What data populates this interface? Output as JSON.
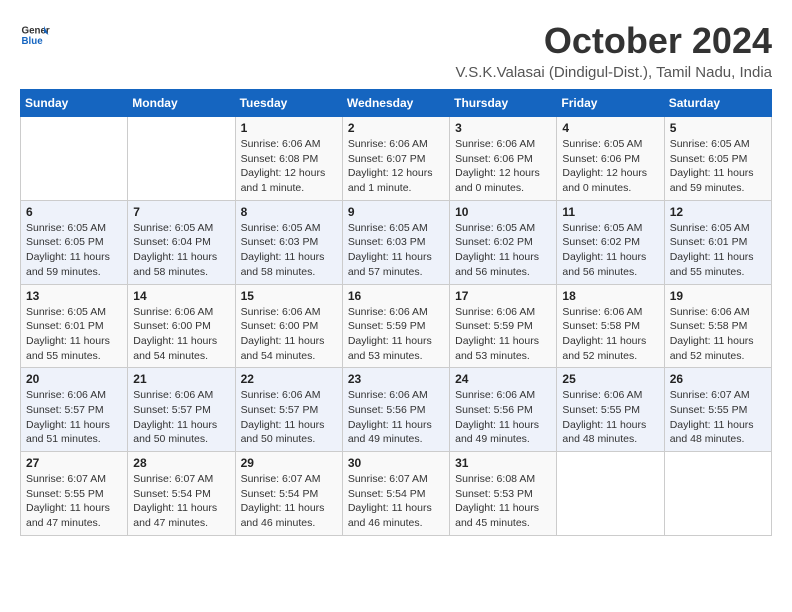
{
  "header": {
    "logo_general": "General",
    "logo_blue": "Blue",
    "title": "October 2024",
    "location": "V.S.K.Valasai (Dindigul-Dist.), Tamil Nadu, India"
  },
  "columns": [
    "Sunday",
    "Monday",
    "Tuesday",
    "Wednesday",
    "Thursday",
    "Friday",
    "Saturday"
  ],
  "weeks": [
    [
      {
        "day": "",
        "detail": ""
      },
      {
        "day": "",
        "detail": ""
      },
      {
        "day": "1",
        "detail": "Sunrise: 6:06 AM\nSunset: 6:08 PM\nDaylight: 12 hours\nand 1 minute."
      },
      {
        "day": "2",
        "detail": "Sunrise: 6:06 AM\nSunset: 6:07 PM\nDaylight: 12 hours\nand 1 minute."
      },
      {
        "day": "3",
        "detail": "Sunrise: 6:06 AM\nSunset: 6:06 PM\nDaylight: 12 hours\nand 0 minutes."
      },
      {
        "day": "4",
        "detail": "Sunrise: 6:05 AM\nSunset: 6:06 PM\nDaylight: 12 hours\nand 0 minutes."
      },
      {
        "day": "5",
        "detail": "Sunrise: 6:05 AM\nSunset: 6:05 PM\nDaylight: 11 hours\nand 59 minutes."
      }
    ],
    [
      {
        "day": "6",
        "detail": "Sunrise: 6:05 AM\nSunset: 6:05 PM\nDaylight: 11 hours\nand 59 minutes."
      },
      {
        "day": "7",
        "detail": "Sunrise: 6:05 AM\nSunset: 6:04 PM\nDaylight: 11 hours\nand 58 minutes."
      },
      {
        "day": "8",
        "detail": "Sunrise: 6:05 AM\nSunset: 6:03 PM\nDaylight: 11 hours\nand 58 minutes."
      },
      {
        "day": "9",
        "detail": "Sunrise: 6:05 AM\nSunset: 6:03 PM\nDaylight: 11 hours\nand 57 minutes."
      },
      {
        "day": "10",
        "detail": "Sunrise: 6:05 AM\nSunset: 6:02 PM\nDaylight: 11 hours\nand 56 minutes."
      },
      {
        "day": "11",
        "detail": "Sunrise: 6:05 AM\nSunset: 6:02 PM\nDaylight: 11 hours\nand 56 minutes."
      },
      {
        "day": "12",
        "detail": "Sunrise: 6:05 AM\nSunset: 6:01 PM\nDaylight: 11 hours\nand 55 minutes."
      }
    ],
    [
      {
        "day": "13",
        "detail": "Sunrise: 6:05 AM\nSunset: 6:01 PM\nDaylight: 11 hours\nand 55 minutes."
      },
      {
        "day": "14",
        "detail": "Sunrise: 6:06 AM\nSunset: 6:00 PM\nDaylight: 11 hours\nand 54 minutes."
      },
      {
        "day": "15",
        "detail": "Sunrise: 6:06 AM\nSunset: 6:00 PM\nDaylight: 11 hours\nand 54 minutes."
      },
      {
        "day": "16",
        "detail": "Sunrise: 6:06 AM\nSunset: 5:59 PM\nDaylight: 11 hours\nand 53 minutes."
      },
      {
        "day": "17",
        "detail": "Sunrise: 6:06 AM\nSunset: 5:59 PM\nDaylight: 11 hours\nand 53 minutes."
      },
      {
        "day": "18",
        "detail": "Sunrise: 6:06 AM\nSunset: 5:58 PM\nDaylight: 11 hours\nand 52 minutes."
      },
      {
        "day": "19",
        "detail": "Sunrise: 6:06 AM\nSunset: 5:58 PM\nDaylight: 11 hours\nand 52 minutes."
      }
    ],
    [
      {
        "day": "20",
        "detail": "Sunrise: 6:06 AM\nSunset: 5:57 PM\nDaylight: 11 hours\nand 51 minutes."
      },
      {
        "day": "21",
        "detail": "Sunrise: 6:06 AM\nSunset: 5:57 PM\nDaylight: 11 hours\nand 50 minutes."
      },
      {
        "day": "22",
        "detail": "Sunrise: 6:06 AM\nSunset: 5:57 PM\nDaylight: 11 hours\nand 50 minutes."
      },
      {
        "day": "23",
        "detail": "Sunrise: 6:06 AM\nSunset: 5:56 PM\nDaylight: 11 hours\nand 49 minutes."
      },
      {
        "day": "24",
        "detail": "Sunrise: 6:06 AM\nSunset: 5:56 PM\nDaylight: 11 hours\nand 49 minutes."
      },
      {
        "day": "25",
        "detail": "Sunrise: 6:06 AM\nSunset: 5:55 PM\nDaylight: 11 hours\nand 48 minutes."
      },
      {
        "day": "26",
        "detail": "Sunrise: 6:07 AM\nSunset: 5:55 PM\nDaylight: 11 hours\nand 48 minutes."
      }
    ],
    [
      {
        "day": "27",
        "detail": "Sunrise: 6:07 AM\nSunset: 5:55 PM\nDaylight: 11 hours\nand 47 minutes."
      },
      {
        "day": "28",
        "detail": "Sunrise: 6:07 AM\nSunset: 5:54 PM\nDaylight: 11 hours\nand 47 minutes."
      },
      {
        "day": "29",
        "detail": "Sunrise: 6:07 AM\nSunset: 5:54 PM\nDaylight: 11 hours\nand 46 minutes."
      },
      {
        "day": "30",
        "detail": "Sunrise: 6:07 AM\nSunset: 5:54 PM\nDaylight: 11 hours\nand 46 minutes."
      },
      {
        "day": "31",
        "detail": "Sunrise: 6:08 AM\nSunset: 5:53 PM\nDaylight: 11 hours\nand 45 minutes."
      },
      {
        "day": "",
        "detail": ""
      },
      {
        "day": "",
        "detail": ""
      }
    ]
  ]
}
